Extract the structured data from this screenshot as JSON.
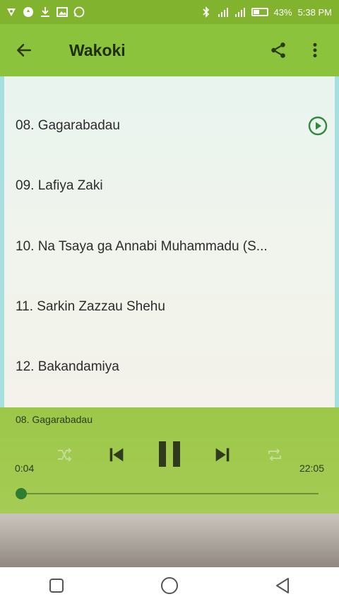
{
  "status_bar": {
    "left_icons": [
      "vpn-icon",
      "data-saver-icon",
      "download-icon",
      "image-icon",
      "whatsapp-icon"
    ],
    "right_icons": [
      "bluetooth-icon",
      "signal-icon",
      "signal-icon"
    ],
    "battery": "43%",
    "time": "5:38 PM"
  },
  "app_bar": {
    "title": "Wakoki",
    "back_icon": "arrow-left-icon",
    "share_icon": "share-icon",
    "menu_icon": "more-vert-icon"
  },
  "tracks": [
    {
      "title": "08. Gagarabadau",
      "playing": true
    },
    {
      "title": "09. Lafiya Zaki",
      "playing": false
    },
    {
      "title": "10. Na Tsaya ga Annabi Muhammadu (S...",
      "playing": false
    },
    {
      "title": "11. Sarkin Zazzau Shehu",
      "playing": false
    },
    {
      "title": "12. Bakandamiya",
      "playing": false
    }
  ],
  "player": {
    "now_playing": "08. Gagarabadau",
    "current_time": "0:04",
    "total_time": "22:05",
    "progress": 0.003
  },
  "colors": {
    "status_bar": "#82b32e",
    "app_bar": "#8bc33c",
    "player_bg": "#a5cc55",
    "accent_play": "#2e8b3a"
  }
}
